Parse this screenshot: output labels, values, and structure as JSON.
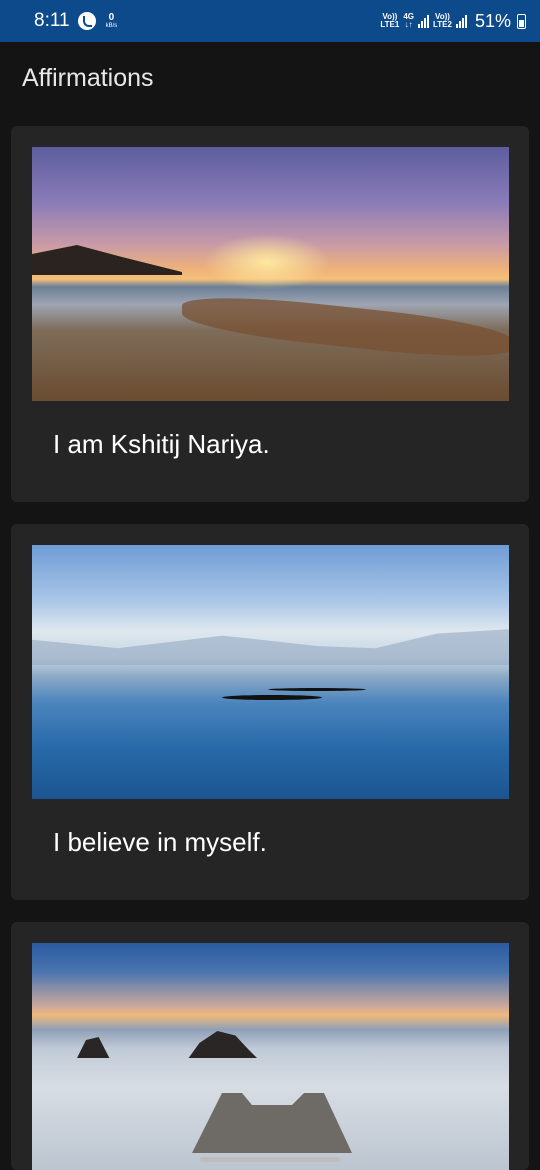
{
  "status_bar": {
    "time": "8:11",
    "data_rate_value": "0",
    "data_rate_unit": "kB/s",
    "sim1_top": "Vo))",
    "sim1_bottom": "LTE1",
    "network_top": "4G",
    "network_bottom": "↓↑",
    "sim2_top": "Vo))",
    "sim2_bottom": "LTE2",
    "battery": "51%",
    "icons": [
      "call-icon",
      "signal-icon",
      "battery-icon"
    ]
  },
  "app": {
    "title": "Affirmations"
  },
  "affirmations": [
    {
      "text": "I am Kshitij Nariya.",
      "image": "beach-sunset"
    },
    {
      "text": "I believe in myself.",
      "image": "lake-kayak"
    },
    {
      "text": "",
      "image": "sea-rocks-pier"
    }
  ],
  "colors": {
    "status_bar": "#0d4a8c",
    "background": "#141414",
    "card": "#252525",
    "text": "#ffffff"
  }
}
